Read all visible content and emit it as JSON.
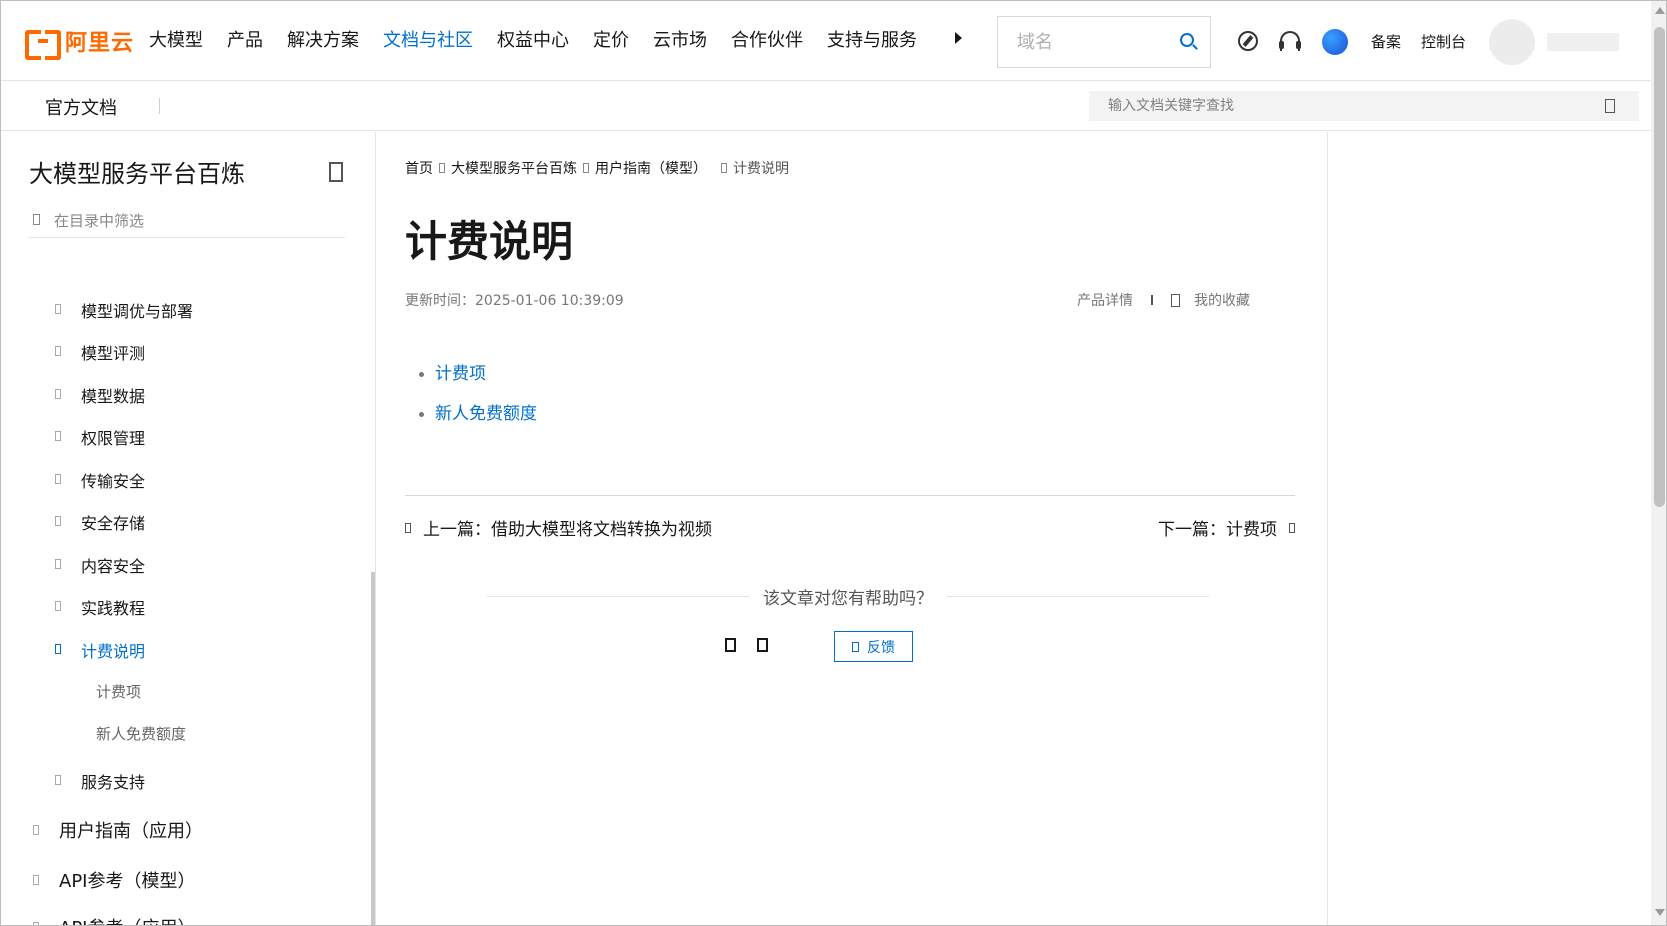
{
  "topnav": {
    "logo_text": "阿里云",
    "items": [
      "大模型",
      "产品",
      "解决方案",
      "文档与社区",
      "权益中心",
      "定价",
      "云市场",
      "合作伙伴",
      "支持与服务"
    ],
    "active_index": 3,
    "search_placeholder": "域名",
    "links": {
      "beian": "备案",
      "console": "控制台"
    },
    "accent_color": "#0070cc",
    "brand_color": "#ff6a00"
  },
  "subnav": {
    "title": "官方文档",
    "search_placeholder": "输入文档关键字查找"
  },
  "sidebar": {
    "title": "大模型服务平台百炼",
    "filter_placeholder": "在目录中筛选",
    "items": [
      {
        "label": "模型调优与部署"
      },
      {
        "label": "模型评测"
      },
      {
        "label": "模型数据"
      },
      {
        "label": "权限管理"
      },
      {
        "label": "传输安全"
      },
      {
        "label": "安全存储"
      },
      {
        "label": "内容安全"
      },
      {
        "label": "实践教程"
      },
      {
        "label": "计费说明"
      },
      {
        "label": "计费项"
      },
      {
        "label": "新人免费额度"
      },
      {
        "label": "服务支持"
      },
      {
        "label": "用户指南（应用）"
      },
      {
        "label": "API参考（模型）"
      },
      {
        "label": "API参考（应用）"
      }
    ]
  },
  "main": {
    "breadcrumbs": [
      "首页",
      "大模型服务平台百炼",
      "用户指南（模型）",
      "计费说明"
    ],
    "title": "计费说明",
    "updated": "更新时间：2025-01-06 10:39:09",
    "product_detail": "产品详情",
    "favorites": "我的收藏",
    "toc": [
      "计费项",
      "新人免费额度"
    ],
    "prev": "上一篇：借助大模型将文档转换为视频",
    "next": "下一篇：计费项",
    "helpful": "该文章对您有帮助吗？",
    "feedback": "反馈"
  }
}
